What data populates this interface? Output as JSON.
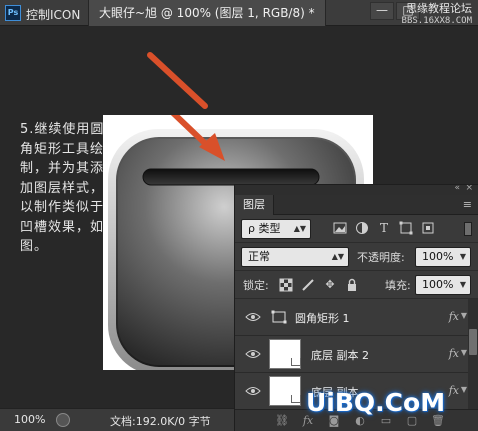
{
  "app": {
    "logo_text": "Ps",
    "title": "控制ICON",
    "document_tab": "大眼仔~旭 @ 100% (图层 1, RGB/8) *",
    "window_buttons": [
      "—",
      "□"
    ]
  },
  "watermark_top": {
    "line1": "思缘教程论坛",
    "line2": "BBS.16XX8.COM"
  },
  "instruction_text": "5.继续使用圆角矩形工具绘制，并为其添加图层样式，以制作类似于凹槽效果，如图。",
  "layers_panel": {
    "tab_label": "图层",
    "collapse_icon": "«",
    "close_icon": "×",
    "menu_icon": "≡",
    "filter": {
      "search_icon": "ρ",
      "kind_label": "类型",
      "filter_icons": [
        "image-filter-icon",
        "adjustment-filter-icon",
        "type-filter-icon",
        "shape-filter-icon",
        "smart-object-filter-icon"
      ]
    },
    "blend_mode": "正常",
    "opacity_label": "不透明度:",
    "opacity_value": "100%",
    "lock_label": "锁定:",
    "fill_label": "填充:",
    "fill_value": "100%",
    "layers": [
      {
        "name": "圆角矩形 1",
        "type": "shape",
        "fx": "fx",
        "visible": true
      },
      {
        "name": "底层 副本 2",
        "type": "pixel",
        "fx": "fx",
        "visible": true
      },
      {
        "name": "底层 副本",
        "type": "pixel",
        "fx": "fx",
        "visible": true
      }
    ],
    "footer_icons": [
      "link-icon",
      "fx-icon",
      "mask-icon",
      "adjustment-icon",
      "group-icon",
      "new-layer-icon",
      "trash-icon"
    ]
  },
  "status": {
    "zoom": "100%",
    "doc_info": "文档:192.0K/0 字节"
  },
  "watermark_bottom": "UiBQ.CoM",
  "colors": {
    "arrow": "#d9502a",
    "panel_bg": "#3a3a3a",
    "workspace_bg": "#282828"
  }
}
